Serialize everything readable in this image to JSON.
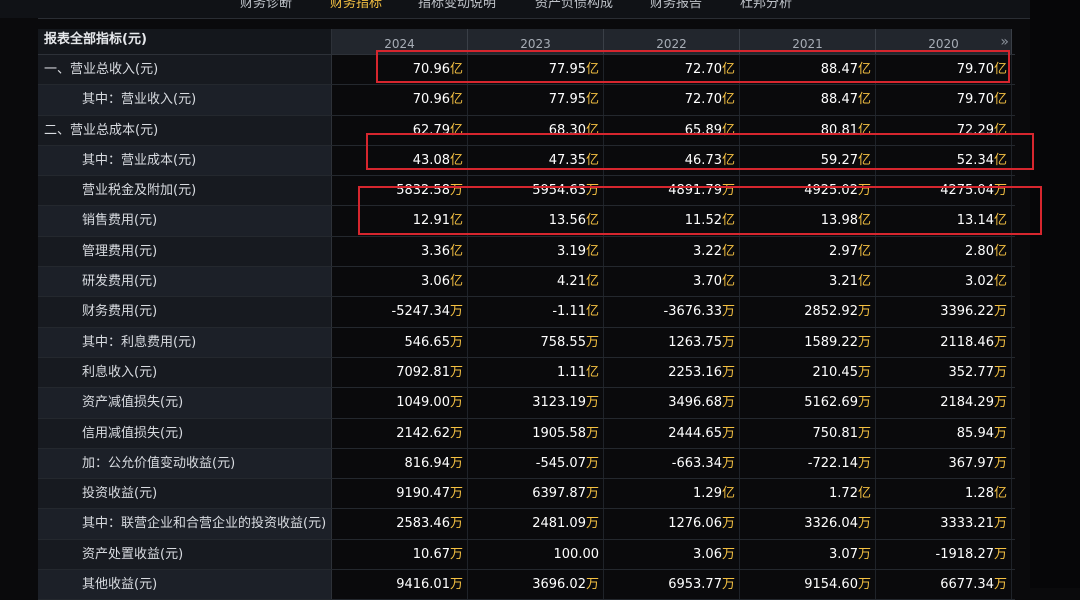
{
  "tabs": [
    {
      "label": "财务诊断",
      "active": false
    },
    {
      "label": "财务指标",
      "active": true
    },
    {
      "label": "指标变动说明",
      "active": false
    },
    {
      "label": "资产负债构成",
      "active": false
    },
    {
      "label": "财务报告",
      "active": false
    },
    {
      "label": "杜邦分析",
      "active": false
    }
  ],
  "table": {
    "header_label": "报表全部指标(元)",
    "years": [
      "2024",
      "2023",
      "2022",
      "2021",
      "2020"
    ],
    "more_icon": "»",
    "rows": [
      {
        "label": "一、营业总收入(元)",
        "level": "major",
        "values": [
          [
            "70.96",
            "亿"
          ],
          [
            "77.95",
            "亿"
          ],
          [
            "72.70",
            "亿"
          ],
          [
            "88.47",
            "亿"
          ],
          [
            "79.70",
            "亿"
          ]
        ]
      },
      {
        "label": "其中：营业收入(元)",
        "level": "sub",
        "values": [
          [
            "70.96",
            "亿"
          ],
          [
            "77.95",
            "亿"
          ],
          [
            "72.70",
            "亿"
          ],
          [
            "88.47",
            "亿"
          ],
          [
            "79.70",
            "亿"
          ]
        ]
      },
      {
        "label": "二、营业总成本(元)",
        "level": "major",
        "values": [
          [
            "62.79",
            "亿"
          ],
          [
            "68.30",
            "亿"
          ],
          [
            "65.89",
            "亿"
          ],
          [
            "80.81",
            "亿"
          ],
          [
            "72.29",
            "亿"
          ]
        ]
      },
      {
        "label": "其中：营业成本(元)",
        "level": "sub",
        "values": [
          [
            "43.08",
            "亿"
          ],
          [
            "47.35",
            "亿"
          ],
          [
            "46.73",
            "亿"
          ],
          [
            "59.27",
            "亿"
          ],
          [
            "52.34",
            "亿"
          ]
        ]
      },
      {
        "label": "营业税金及附加(元)",
        "level": "sub",
        "values": [
          [
            "5832.58",
            "万"
          ],
          [
            "5954.63",
            "万"
          ],
          [
            "4891.79",
            "万"
          ],
          [
            "4925.02",
            "万"
          ],
          [
            "4275.04",
            "万"
          ]
        ]
      },
      {
        "label": "销售费用(元)",
        "level": "sub",
        "values": [
          [
            "12.91",
            "亿"
          ],
          [
            "13.56",
            "亿"
          ],
          [
            "11.52",
            "亿"
          ],
          [
            "13.98",
            "亿"
          ],
          [
            "13.14",
            "亿"
          ]
        ]
      },
      {
        "label": "管理费用(元)",
        "level": "sub",
        "values": [
          [
            "3.36",
            "亿"
          ],
          [
            "3.19",
            "亿"
          ],
          [
            "3.22",
            "亿"
          ],
          [
            "2.97",
            "亿"
          ],
          [
            "2.80",
            "亿"
          ]
        ]
      },
      {
        "label": "研发费用(元)",
        "level": "sub",
        "values": [
          [
            "3.06",
            "亿"
          ],
          [
            "4.21",
            "亿"
          ],
          [
            "3.70",
            "亿"
          ],
          [
            "3.21",
            "亿"
          ],
          [
            "3.02",
            "亿"
          ]
        ]
      },
      {
        "label": "财务费用(元)",
        "level": "sub",
        "values": [
          [
            "-5247.34",
            "万"
          ],
          [
            "-1.11",
            "亿"
          ],
          [
            "-3676.33",
            "万"
          ],
          [
            "2852.92",
            "万"
          ],
          [
            "3396.22",
            "万"
          ]
        ]
      },
      {
        "label": "其中：利息费用(元)",
        "level": "sub",
        "values": [
          [
            "546.65",
            "万"
          ],
          [
            "758.55",
            "万"
          ],
          [
            "1263.75",
            "万"
          ],
          [
            "1589.22",
            "万"
          ],
          [
            "2118.46",
            "万"
          ]
        ]
      },
      {
        "label": "利息收入(元)",
        "level": "sub",
        "values": [
          [
            "7092.81",
            "万"
          ],
          [
            "1.11",
            "亿"
          ],
          [
            "2253.16",
            "万"
          ],
          [
            "210.45",
            "万"
          ],
          [
            "352.77",
            "万"
          ]
        ]
      },
      {
        "label": "资产减值损失(元)",
        "level": "sub",
        "values": [
          [
            "1049.00",
            "万"
          ],
          [
            "3123.19",
            "万"
          ],
          [
            "3496.68",
            "万"
          ],
          [
            "5162.69",
            "万"
          ],
          [
            "2184.29",
            "万"
          ]
        ]
      },
      {
        "label": "信用减值损失(元)",
        "level": "sub",
        "values": [
          [
            "2142.62",
            "万"
          ],
          [
            "1905.58",
            "万"
          ],
          [
            "2444.65",
            "万"
          ],
          [
            "750.81",
            "万"
          ],
          [
            "85.94",
            "万"
          ]
        ]
      },
      {
        "label": "加：公允价值变动收益(元)",
        "level": "sub",
        "values": [
          [
            "816.94",
            "万"
          ],
          [
            "-545.07",
            "万"
          ],
          [
            "-663.34",
            "万"
          ],
          [
            "-722.14",
            "万"
          ],
          [
            "367.97",
            "万"
          ]
        ]
      },
      {
        "label": "投资收益(元)",
        "level": "sub",
        "values": [
          [
            "9190.47",
            "万"
          ],
          [
            "6397.87",
            "万"
          ],
          [
            "1.29",
            "亿"
          ],
          [
            "1.72",
            "亿"
          ],
          [
            "1.28",
            "亿"
          ]
        ]
      },
      {
        "label": "其中：联营企业和合营企业的投资收益(元)",
        "level": "sub",
        "values": [
          [
            "2583.46",
            "万"
          ],
          [
            "2481.09",
            "万"
          ],
          [
            "1276.06",
            "万"
          ],
          [
            "3326.04",
            "万"
          ],
          [
            "3333.21",
            "万"
          ]
        ]
      },
      {
        "label": "资产处置收益(元)",
        "level": "sub",
        "values": [
          [
            "10.67",
            "万"
          ],
          [
            "100.00",
            ""
          ],
          [
            "3.06",
            "万"
          ],
          [
            "3.07",
            "万"
          ],
          [
            "-1918.27",
            "万"
          ]
        ]
      },
      {
        "label": "其他收益(元)",
        "level": "sub",
        "values": [
          [
            "9416.01",
            "万"
          ],
          [
            "3696.02",
            "万"
          ],
          [
            "6953.77",
            "万"
          ],
          [
            "9154.60",
            "万"
          ],
          [
            "6677.34",
            "万"
          ]
        ]
      }
    ]
  },
  "highlights": [
    "一、营业总收入(元)",
    "其中：营业成本(元)",
    "销售费用(元)"
  ],
  "colors": {
    "unit": "#f5c142",
    "active_tab": "#f5c142",
    "highlight_box": "#d6262e"
  }
}
